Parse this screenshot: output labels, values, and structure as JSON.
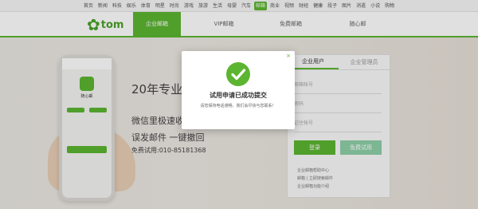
{
  "topnav": [
    "首页",
    "新闻",
    "科技",
    "娱乐",
    "体育",
    "明星",
    "时尚",
    "游戏",
    "旅游",
    "生活",
    "母婴",
    "汽车",
    "邮箱",
    "商业",
    "视频",
    "财经",
    "健康",
    "段子",
    "图片",
    "消遣",
    "小说",
    "购物"
  ],
  "topnav_active_index": 12,
  "logo": {
    "mark": "✿",
    "word": "tom"
  },
  "tabs": [
    {
      "label": "企业邮箱",
      "active": true
    },
    {
      "label": "VIP邮箱",
      "active": false
    },
    {
      "label": "免费邮箱",
      "active": false
    },
    {
      "label": "随心邮",
      "active": false
    }
  ],
  "phone": {
    "app_title": "随心邮"
  },
  "slogans": {
    "line1": "20年专业服",
    "line2": "微信里极速收",
    "line3": "误发邮件 一键撤回",
    "line4": "免费试用:010-85181368"
  },
  "login": {
    "tabs": [
      "企业用户",
      "企业管理员"
    ],
    "fields": [
      "邮箱帐号",
      "密码",
      "记住帐号"
    ],
    "login_button": "登录",
    "trial_button": "免费试用",
    "links": [
      "企业邮箱帮助中心",
      "邮箱 | 立即搜索邮件",
      "企业邮箱功能介绍"
    ]
  },
  "modal": {
    "title": "试用申请已成功提交",
    "subtitle": "请您保持电话通畅，我们会尽快与您联系！",
    "close": "×"
  },
  "colors": {
    "brand": "#5cb531"
  }
}
